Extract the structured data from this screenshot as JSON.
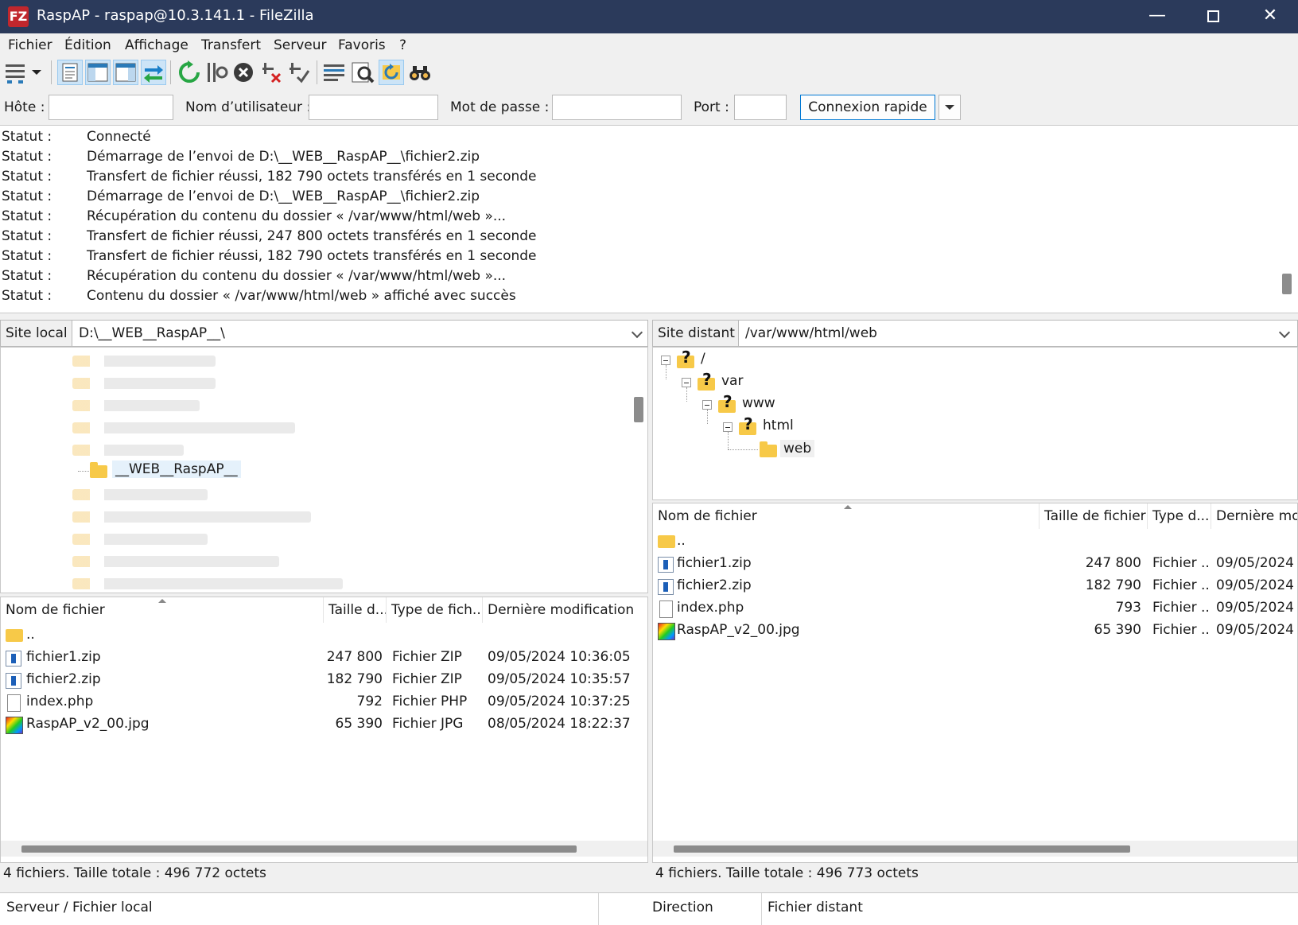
{
  "window": {
    "title": "RaspAP - raspap@10.3.141.1 - FileZilla",
    "logo_text": "FZ",
    "minimize_glyph": "—",
    "close_glyph": "✕"
  },
  "menu": [
    "Fichier",
    "Édition",
    "Affichage",
    "Transfert",
    "Serveur",
    "Favoris",
    "?"
  ],
  "toolbar": {
    "icons": [
      "site-manager-icon",
      "dropdown-arrow-icon",
      "toggle-log-icon",
      "toggle-local-tree-icon",
      "toggle-remote-tree-icon",
      "toggle-queue-icon",
      "refresh-icon",
      "process-queue-icon",
      "cancel-icon",
      "disconnect-icon",
      "reconnect-icon",
      "directory-listing-filters-icon",
      "compare-directories-icon",
      "synchronized-browsing-icon",
      "search-icon"
    ]
  },
  "quickconnect": {
    "host_label": "Hôte :",
    "host_value": "",
    "user_label": "Nom d’utilisateur :",
    "user_value": "",
    "pass_label": "Mot de passe :",
    "pass_value": "",
    "port_label": "Port :",
    "port_value": "",
    "connect_label": "Connexion rapide"
  },
  "log": [
    {
      "k": "Statut :",
      "v": "Connecté"
    },
    {
      "k": "Statut :",
      "v": "Démarrage de l’envoi de D:\\__WEB__RaspAP__\\fichier2.zip"
    },
    {
      "k": "Statut :",
      "v": "Transfert de fichier réussi, 182 790 octets transférés en 1 seconde"
    },
    {
      "k": "Statut :",
      "v": "Démarrage de l’envoi de D:\\__WEB__RaspAP__\\fichier2.zip"
    },
    {
      "k": "Statut :",
      "v": "Récupération du contenu du dossier « /var/www/html/web »..."
    },
    {
      "k": "Statut :",
      "v": "Transfert de fichier réussi, 247 800 octets transférés en 1 seconde"
    },
    {
      "k": "Statut :",
      "v": "Transfert de fichier réussi, 182 790 octets transférés en 1 seconde"
    },
    {
      "k": "Statut :",
      "v": "Récupération du contenu du dossier « /var/www/html/web »..."
    },
    {
      "k": "Statut :",
      "v": "Contenu du dossier « /var/www/html/web » affiché avec succès"
    }
  ],
  "local": {
    "site_label": "Site local :",
    "path": "D:\\__WEB__RaspAP__\\",
    "tree_selected": "__WEB__RaspAP__",
    "columns": [
      "Nom de fichier",
      "Taille d...",
      "Type de fich...",
      "Dernière modification"
    ],
    "files": [
      {
        "name": "..",
        "size": "",
        "type": "",
        "modified": "",
        "icon": "parent-folder-icon"
      },
      {
        "name": "fichier1.zip",
        "size": "247 800",
        "type": "Fichier ZIP",
        "modified": "09/05/2024 10:36:05",
        "icon": "zip-file-icon"
      },
      {
        "name": "fichier2.zip",
        "size": "182 790",
        "type": "Fichier ZIP",
        "modified": "09/05/2024 10:35:57",
        "icon": "zip-file-icon"
      },
      {
        "name": "index.php",
        "size": "792",
        "type": "Fichier PHP",
        "modified": "09/05/2024 10:37:25",
        "icon": "php-file-icon"
      },
      {
        "name": "RaspAP_v2_00.jpg",
        "size": "65 390",
        "type": "Fichier JPG",
        "modified": "08/05/2024 18:22:37",
        "icon": "jpg-file-icon"
      }
    ],
    "status": "4 fichiers. Taille totale : 496 772 octets"
  },
  "remote": {
    "site_label": "Site distant :",
    "path": "/var/www/html/web",
    "tree": [
      "/",
      "var",
      "www",
      "html",
      "web"
    ],
    "columns": [
      "Nom de fichier",
      "Taille de fichier",
      "Type d...",
      "Dernière modi"
    ],
    "files": [
      {
        "name": "..",
        "size": "",
        "type": "",
        "modified": "",
        "icon": "parent-folder-icon"
      },
      {
        "name": "fichier1.zip",
        "size": "247 800",
        "type": "Fichier ...",
        "modified": "09/05/2024",
        "icon": "zip-file-icon"
      },
      {
        "name": "fichier2.zip",
        "size": "182 790",
        "type": "Fichier ...",
        "modified": "09/05/2024",
        "icon": "zip-file-icon"
      },
      {
        "name": "index.php",
        "size": "793",
        "type": "Fichier ...",
        "modified": "09/05/2024",
        "icon": "php-file-icon"
      },
      {
        "name": "RaspAP_v2_00.jpg",
        "size": "65 390",
        "type": "Fichier ...",
        "modified": "09/05/2024",
        "icon": "jpg-file-icon"
      }
    ],
    "status": "4 fichiers. Taille totale : 496 773 octets"
  },
  "queue": {
    "col1": "Serveur / Fichier local",
    "col2": "Direction",
    "col3": "Fichier distant"
  }
}
